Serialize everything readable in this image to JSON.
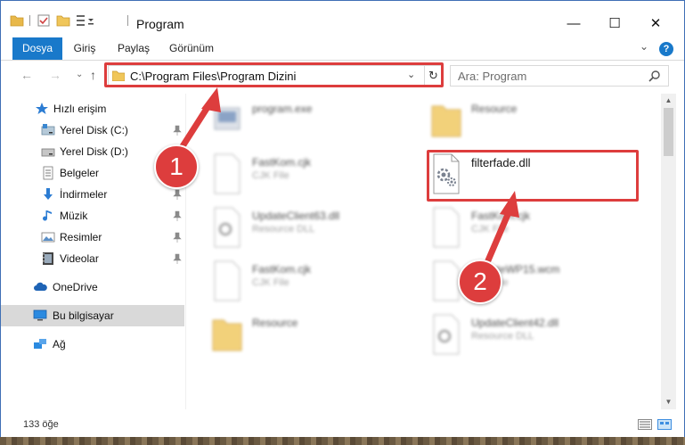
{
  "window": {
    "title": "Program",
    "controls": {
      "minimize": "—",
      "maximize": "☐",
      "close": "✕"
    }
  },
  "ribbon": {
    "tabs": [
      {
        "label": "Dosya",
        "active": true
      },
      {
        "label": "Giriş",
        "active": false
      },
      {
        "label": "Paylaş",
        "active": false
      },
      {
        "label": "Görünüm",
        "active": false
      }
    ],
    "help": "?"
  },
  "address_bar": {
    "path": "C:\\Program Files\\Program Dizini"
  },
  "search": {
    "placeholder": "Ara: Program"
  },
  "sidebar": {
    "items": [
      {
        "label": "Hızlı erişim",
        "icon": "star-icon",
        "pinned": false
      },
      {
        "label": "Yerel Disk (C:)",
        "icon": "drive-icon",
        "pinned": true
      },
      {
        "label": "Yerel Disk (D:)",
        "icon": "drive-icon",
        "pinned": false
      },
      {
        "label": "Belgeler",
        "icon": "documents-icon",
        "pinned": true
      },
      {
        "label": "İndirmeler",
        "icon": "download-icon",
        "pinned": true
      },
      {
        "label": "Müzik",
        "icon": "music-icon",
        "pinned": true
      },
      {
        "label": "Resimler",
        "icon": "pictures-icon",
        "pinned": true
      },
      {
        "label": "Videolar",
        "icon": "videos-icon",
        "pinned": true
      },
      {
        "label": "OneDrive",
        "icon": "cloud-icon",
        "pinned": false
      },
      {
        "label": "Bu bilgisayar",
        "icon": "computer-icon",
        "pinned": false,
        "selected": true
      },
      {
        "label": "Ağ",
        "icon": "network-icon",
        "pinned": false
      }
    ]
  },
  "files": [
    {
      "name": "program.exe",
      "type": "",
      "icon": "exe-icon",
      "blurred": true
    },
    {
      "name": "Resource",
      "type": "",
      "icon": "folder-icon",
      "blurred": true
    },
    {
      "name": "FastKom.cjk",
      "type": "CJK File",
      "icon": "file-icon",
      "blurred": true
    },
    {
      "name": "filterfade.dll",
      "type": "",
      "icon": "dll-icon",
      "blurred": false
    },
    {
      "name": "UpdateClient63.dll",
      "type": "Resource DLL",
      "icon": "dll-icon",
      "blurred": true
    },
    {
      "name": "FastKom.cjk",
      "type": "CJK File",
      "icon": "file-icon",
      "blurred": true
    },
    {
      "name": "FastKom.cjk",
      "type": "CJK File",
      "icon": "file-icon",
      "blurred": true
    },
    {
      "name": "UpdateWP15.wcm",
      "type": "CJK File",
      "icon": "file-icon",
      "blurred": true
    },
    {
      "name": "Resource",
      "type": "",
      "icon": "folder-icon",
      "blurred": true
    },
    {
      "name": "UpdateClient42.dll",
      "type": "Resource DLL",
      "icon": "dll-icon",
      "blurred": true
    }
  ],
  "status": {
    "count": "133 öğe"
  },
  "annotations": {
    "badge_1": "1",
    "badge_2": "2",
    "color": "#dd3d3d"
  }
}
